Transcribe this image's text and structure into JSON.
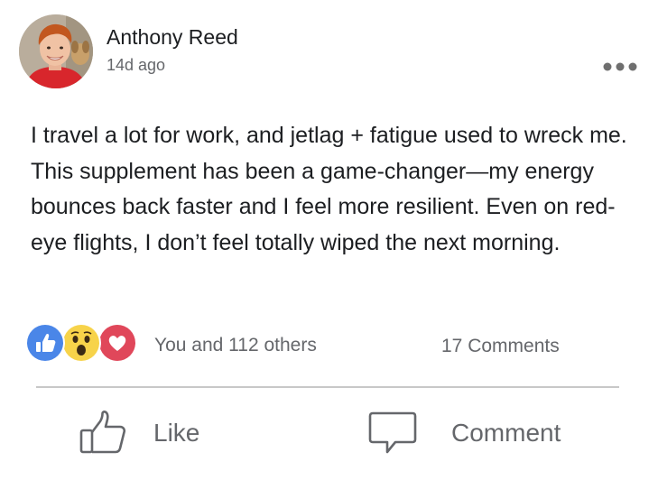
{
  "post": {
    "author_name": "Anthony Reed",
    "timestamp": "14d ago",
    "more_icon": "ellipsis-icon",
    "text": "I travel a lot for work, and jetlag + fatigue used to wreck me. This supplement has been a game-changer—my energy bounces back faster and I feel more resilient. Even on red-eye flights, I don’t feel totally wiped the next morning."
  },
  "engagement": {
    "reactions": [
      "like-reaction-icon",
      "wow-reaction-icon",
      "love-reaction-icon"
    ],
    "reaction_summary": "You and 112 others",
    "comments_count": "17 Comments"
  },
  "actions": {
    "like_label": "Like",
    "comment_label": "Comment"
  },
  "colors": {
    "like_blue": "#4a86e8",
    "wow_yellow": "#f7d34a",
    "love_red": "#e0475a",
    "secondary_text": "#65676b",
    "divider": "#c8c8c8"
  }
}
